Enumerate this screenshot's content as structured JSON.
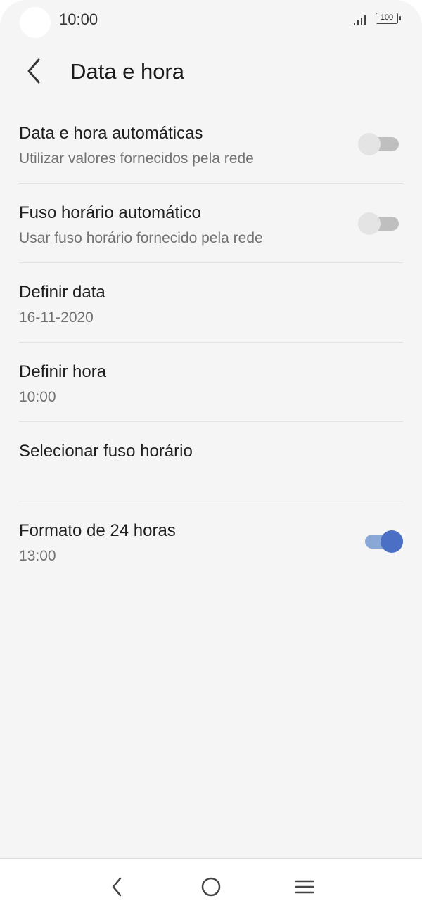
{
  "status_bar": {
    "time": "10:00",
    "battery": "100",
    "icons": [
      "signal-icon",
      "battery-icon"
    ]
  },
  "header": {
    "title": "Data e hora",
    "back_icon": "back-arrow-icon"
  },
  "settings": [
    {
      "title": "Data e hora automáticas",
      "subtitle": "Utilizar valores fornecidos pela rede",
      "toggle": false
    },
    {
      "title": "Fuso horário automático",
      "subtitle": "Usar fuso horário fornecido pela rede",
      "toggle": false
    },
    {
      "title": "Definir data",
      "subtitle": "16-11-2020"
    },
    {
      "title": "Definir hora",
      "subtitle": "10:00"
    },
    {
      "title": "Selecionar fuso horário",
      "subtitle": ""
    },
    {
      "title": "Formato de 24 horas",
      "subtitle": "13:00",
      "toggle": true
    }
  ],
  "nav_bar": {
    "icons": [
      "back-icon",
      "home-icon",
      "menu-icon"
    ]
  },
  "colors": {
    "accent": "#4a6fc4",
    "accent_track": "#8aa8d6",
    "background": "#f5f5f5",
    "switch_off": "#bfbfbf"
  }
}
